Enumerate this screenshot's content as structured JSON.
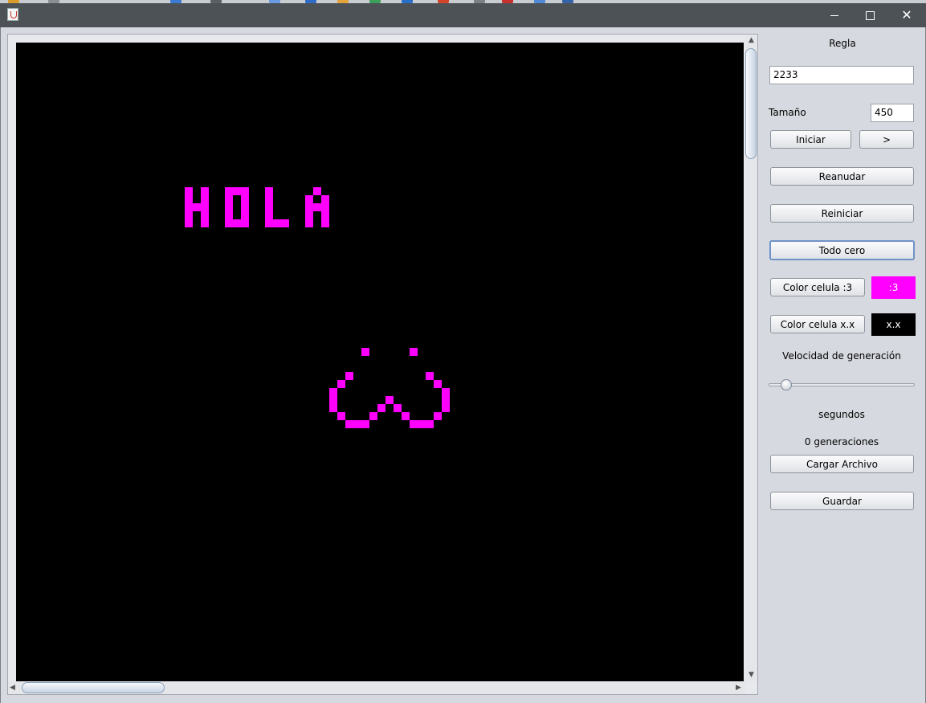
{
  "colors": {
    "title_bar": "#4d5257",
    "window_bg": "#d6d9df",
    "live_cell": "#ff00ff",
    "dead_cell": "#000000"
  },
  "window": {
    "icon": "java-cup-icon",
    "controls": [
      "minimize-icon",
      "maximize-icon",
      "close-icon"
    ]
  },
  "panel": {
    "rule_label": "Regla",
    "rule_value": "2233",
    "size_label": "Tamaño",
    "size_value": "450",
    "start_button": "Iniciar",
    "step_button": ">",
    "resume_button": "Reanudar",
    "restart_button": "Reiniciar",
    "all_zero_button": "Todo cero",
    "alive_color_button": "Color celula :3",
    "alive_color_swatch": ":3",
    "dead_color_button": "Color celula x.x",
    "dead_color_swatch": "x.x",
    "speed_label": "Velocidad de generación",
    "speed_value": 0.1,
    "seconds_label": "segundos",
    "generations_label": "0 generaciones",
    "load_button": "Cargar Archivo",
    "save_button": "Guardar"
  },
  "grid": {
    "text_pattern": "HOLA",
    "live_cells": [
      [
        21,
        18
      ],
      [
        21,
        19
      ],
      [
        21,
        20
      ],
      [
        21,
        21
      ],
      [
        21,
        22
      ],
      [
        22,
        20
      ],
      [
        23,
        18
      ],
      [
        23,
        19
      ],
      [
        23,
        20
      ],
      [
        23,
        21
      ],
      [
        23,
        22
      ],
      [
        26,
        18
      ],
      [
        26,
        19
      ],
      [
        26,
        20
      ],
      [
        26,
        21
      ],
      [
        26,
        22
      ],
      [
        27,
        18
      ],
      [
        27,
        22
      ],
      [
        28,
        18
      ],
      [
        28,
        19
      ],
      [
        28,
        20
      ],
      [
        28,
        21
      ],
      [
        28,
        22
      ],
      [
        31,
        18
      ],
      [
        31,
        19
      ],
      [
        31,
        20
      ],
      [
        31,
        21
      ],
      [
        31,
        22
      ],
      [
        32,
        22
      ],
      [
        33,
        22
      ],
      [
        36,
        19
      ],
      [
        36,
        20
      ],
      [
        36,
        21
      ],
      [
        36,
        22
      ],
      [
        37,
        18
      ],
      [
        37,
        20
      ],
      [
        38,
        19
      ],
      [
        38,
        20
      ],
      [
        38,
        21
      ],
      [
        38,
        22
      ],
      [
        43,
        38
      ],
      [
        49,
        38
      ],
      [
        41,
        41
      ],
      [
        51,
        41
      ],
      [
        40,
        42
      ],
      [
        52,
        42
      ],
      [
        39,
        43
      ],
      [
        39,
        44
      ],
      [
        39,
        45
      ],
      [
        53,
        43
      ],
      [
        53,
        44
      ],
      [
        53,
        45
      ],
      [
        46,
        44
      ],
      [
        45,
        45
      ],
      [
        47,
        45
      ],
      [
        40,
        46
      ],
      [
        44,
        46
      ],
      [
        48,
        46
      ],
      [
        52,
        46
      ],
      [
        41,
        47
      ],
      [
        42,
        47
      ],
      [
        43,
        47
      ],
      [
        49,
        47
      ],
      [
        50,
        47
      ],
      [
        51,
        47
      ]
    ]
  }
}
